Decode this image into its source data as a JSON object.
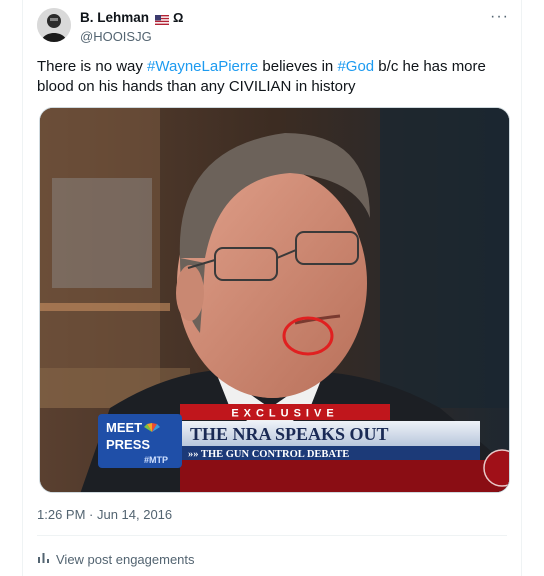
{
  "author": {
    "display_name": "B. Lehman",
    "badge": "Ω",
    "handle": "@HOOISJG"
  },
  "tweet": {
    "text_parts": [
      "There is no way ",
      "#WayneLaPierre",
      " believes in ",
      "#God",
      " b/c he has more blood on his hands than any CIVILIAN in history"
    ],
    "timestamp": "1:26 PM · Jun 14, 2016",
    "engagements_label": "View post engagements"
  },
  "media": {
    "banner_top": "EXCLUSIVE",
    "banner_title": "THE NRA SPEAKS OUT",
    "banner_subtitle": "»» THE GUN CONTROL DEBATE",
    "logo_line1": "MEET",
    "logo_line2": "PRESS",
    "logo_tag": "#MTP"
  },
  "colors": {
    "link": "#1d9bf0",
    "muted": "#536471",
    "circle": "#e02020"
  },
  "icons": {
    "more": "more-horizontal-icon",
    "engagements": "bar-chart-icon"
  }
}
